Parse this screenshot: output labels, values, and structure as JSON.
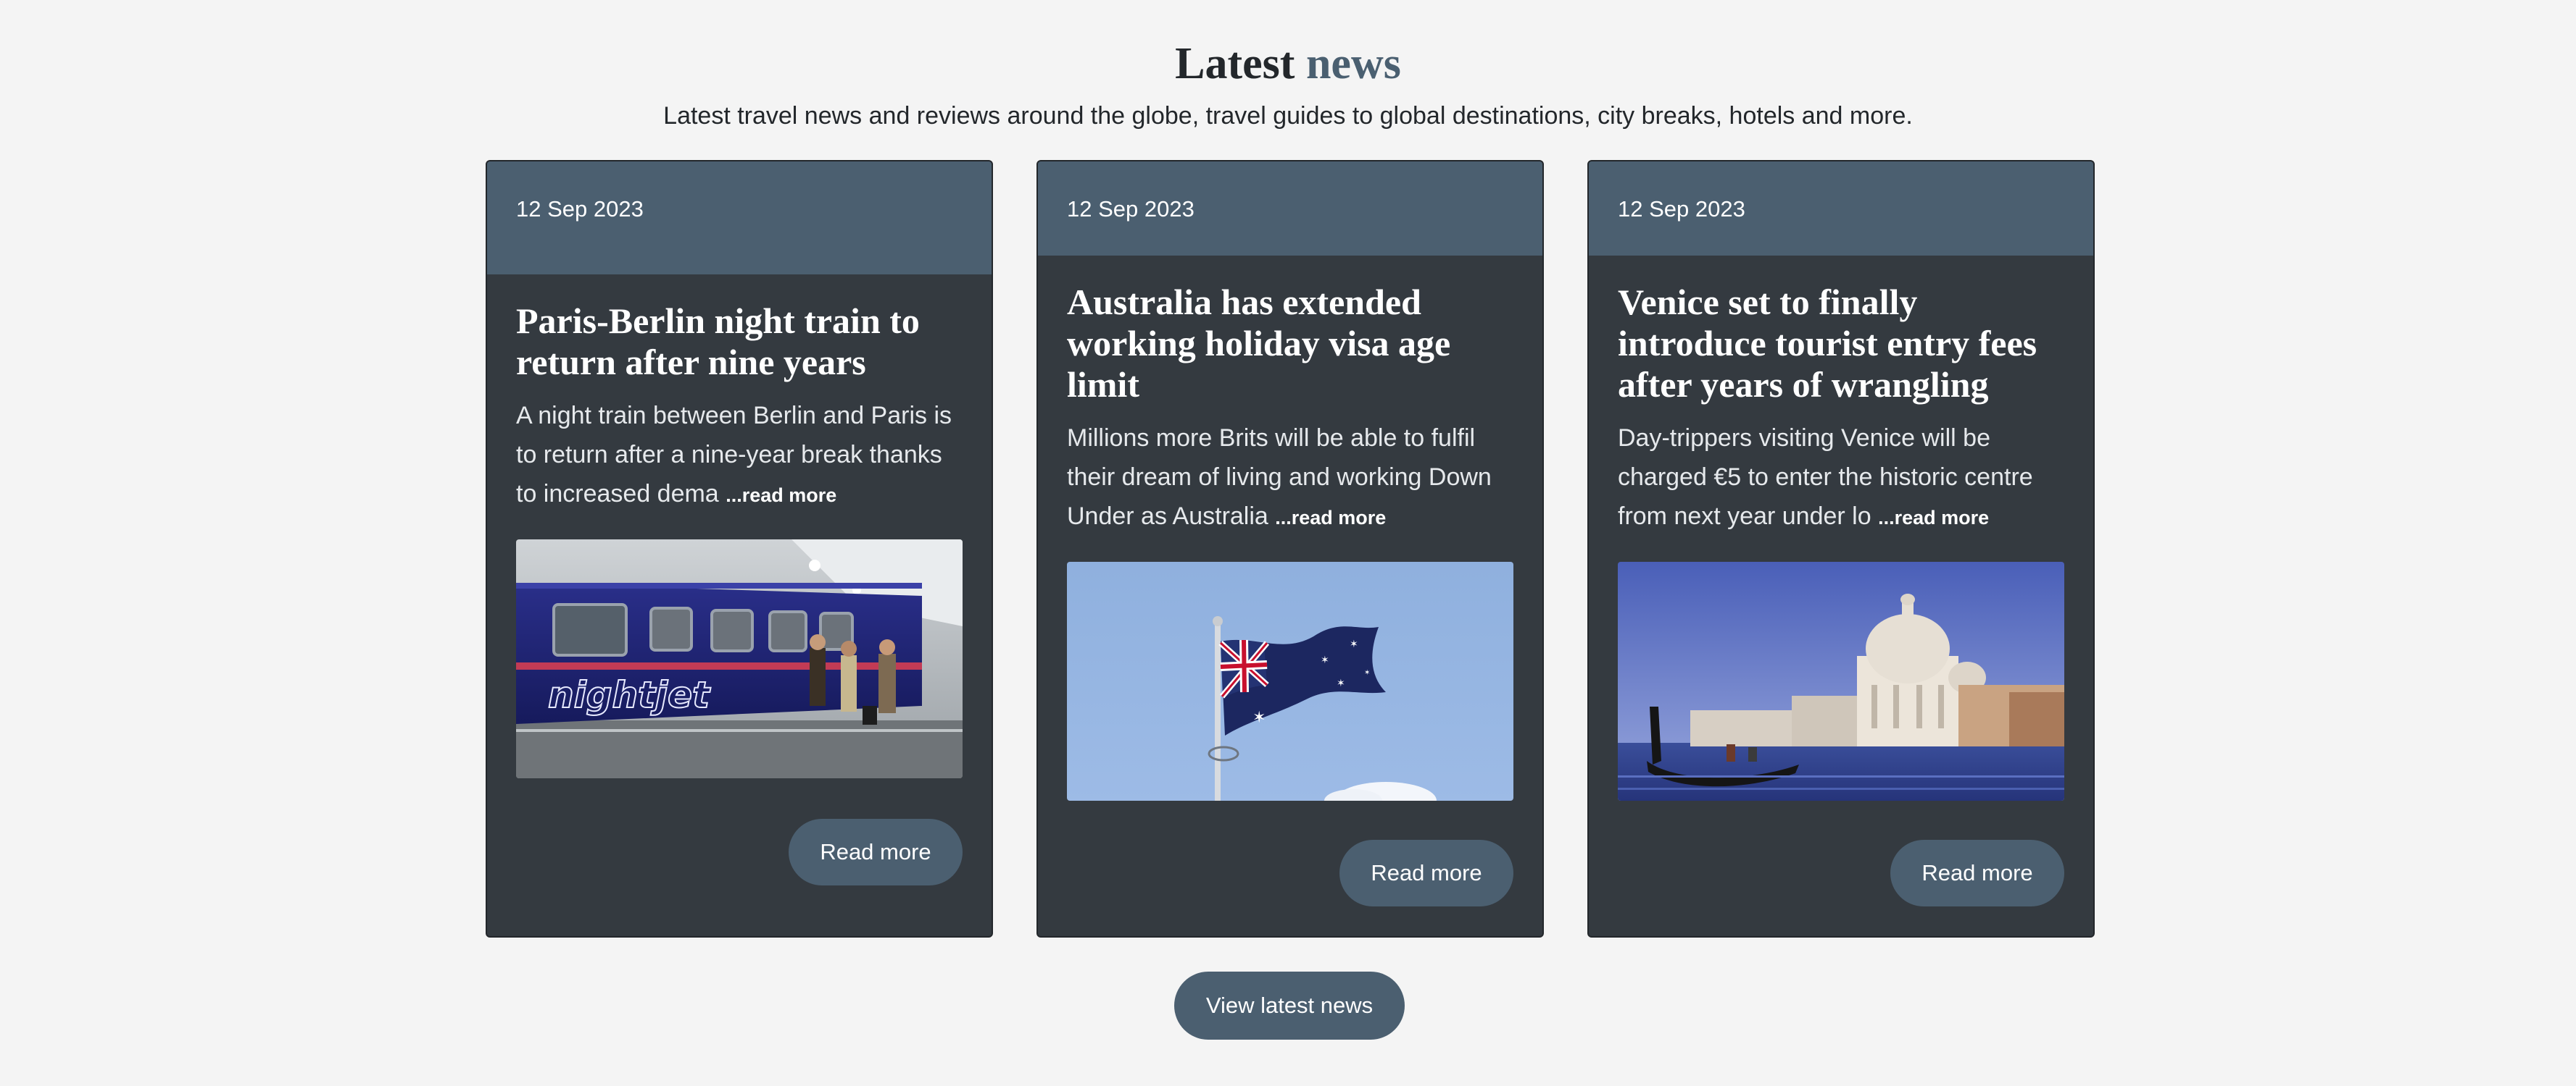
{
  "section": {
    "title_main": "Latest",
    "title_accent": "news",
    "subtitle": "Latest travel news and reviews around the globe, travel guides to global destinations, city breaks, hotels and more."
  },
  "cards": [
    {
      "date": "12 Sep 2023",
      "title": "Paris-Berlin night train to return after nine years",
      "excerpt": "A night train between Berlin and Paris is to return after a nine-year break thanks to increased dema",
      "more_link": "...read more",
      "image": "night-train-image",
      "image_text": "nightjet",
      "button": "Read more"
    },
    {
      "date": "12 Sep 2023",
      "title": "Australia has extended working holiday visa age limit",
      "excerpt": "Millions more Brits will be able to fulfil their dream of living and working Down Under as Australia",
      "more_link": "...read more",
      "image": "australian-flag-image",
      "button": "Read more"
    },
    {
      "date": "12 Sep 2023",
      "title": "Venice set to finally introduce tourist entry fees after years of wrangling",
      "excerpt": "Day-trippers visiting Venice will be charged €5 to enter the historic centre from next year under lo",
      "more_link": "...read more",
      "image": "venice-gondola-image",
      "button": "Read more"
    }
  ],
  "footer": {
    "view_all": "View latest news"
  },
  "colors": {
    "page_bg": "#f4f4f4",
    "card_bg": "#343a40",
    "card_header_bg": "#4b5f70",
    "button_bg": "#4b5f70",
    "accent_text": "#4a5f70"
  }
}
